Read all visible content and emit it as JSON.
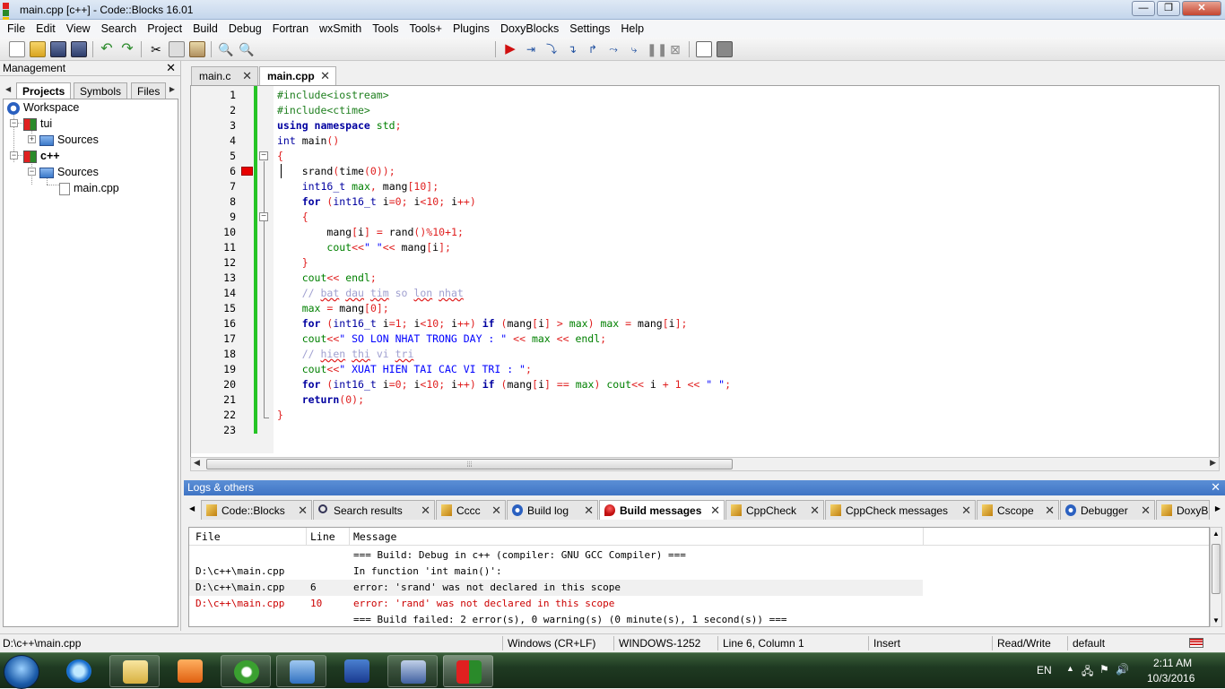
{
  "window": {
    "title": "main.cpp [c++] - Code::Blocks 16.01"
  },
  "menu": [
    "File",
    "Edit",
    "View",
    "Search",
    "Project",
    "Build",
    "Debug",
    "Fortran",
    "wxSmith",
    "Tools",
    "Tools+",
    "Plugins",
    "DoxyBlocks",
    "Settings",
    "Help"
  ],
  "management": {
    "title": "Management",
    "tabs": [
      "Projects",
      "Symbols",
      "Files"
    ],
    "tree": {
      "workspace": "Workspace",
      "project1": "tui",
      "project1_folder": "Sources",
      "project2": "c++",
      "project2_folder": "Sources",
      "file": "main.cpp"
    }
  },
  "editor": {
    "tabs": [
      "main.c",
      "main.cpp"
    ],
    "active_tab": "main.cpp",
    "line_numbers": [
      "1",
      "2",
      "3",
      "4",
      "5",
      "6",
      "7",
      "8",
      "9",
      "10",
      "11",
      "12",
      "13",
      "14",
      "15",
      "16",
      "17",
      "18",
      "19",
      "20",
      "21",
      "22",
      "23"
    ],
    "error_line": 6
  },
  "logs": {
    "title": "Logs & others",
    "tabs": [
      "Code::Blocks",
      "Search results",
      "Cccc",
      "Build log",
      "Build messages",
      "CppCheck",
      "CppCheck messages",
      "Cscope",
      "Debugger",
      "DoxyB"
    ],
    "active_tab": "Build messages",
    "columns": [
      "File",
      "Line",
      "Message"
    ],
    "rows": [
      {
        "file": "",
        "line": "",
        "message": "=== Build: Debug in c++ (compiler: GNU GCC Compiler) ==="
      },
      {
        "file": "D:\\c++\\main.cpp",
        "line": "",
        "message": "In function 'int main()':"
      },
      {
        "file": "D:\\c++\\main.cpp",
        "line": "6",
        "message": "error: 'srand' was not declared in this scope"
      },
      {
        "file": "D:\\c++\\main.cpp",
        "line": "10",
        "message": "error: 'rand' was not declared in this scope"
      },
      {
        "file": "",
        "line": "",
        "message": "=== Build failed: 2 error(s), 0 warning(s) (0 minute(s), 1 second(s)) ==="
      }
    ]
  },
  "status": {
    "path": "D:\\c++\\main.cpp",
    "eol": "Windows (CR+LF)",
    "encoding": "WINDOWS-1252",
    "position": "Line 6, Column 1",
    "mode": "Insert",
    "access": "Read/Write",
    "profile": "default"
  },
  "taskbar": {
    "lang": "EN",
    "time": "2:11 AM",
    "date": "10/3/2016"
  }
}
